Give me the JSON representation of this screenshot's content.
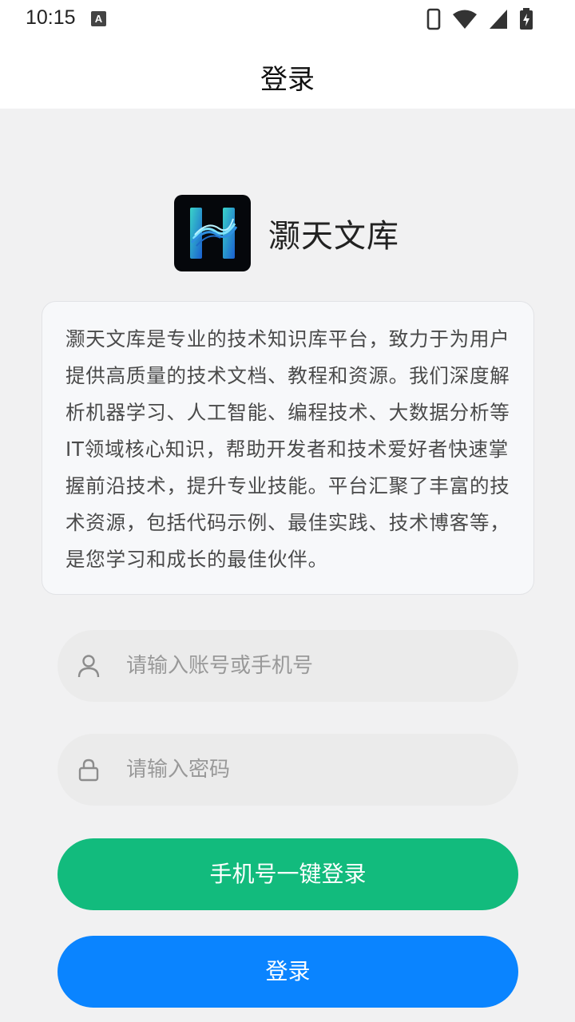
{
  "status_bar": {
    "time": "10:15",
    "keyboard_indicator": "A",
    "icons": [
      "phone-icon",
      "wifi-icon",
      "cellular-signal-icon",
      "battery-charging-icon"
    ]
  },
  "header": {
    "title": "登录"
  },
  "app": {
    "name": "灏天文库",
    "logo_icon": "h-logo-icon",
    "intro": "灏天文库是专业的技术知识库平台，致力于为用户提供高质量的技术文档、教程和资源。我们深度解析机器学习、人工智能、编程技术、大数据分析等IT领域核心知识，帮助开发者和技术爱好者快速掌握前沿技术，提升专业技能。平台汇聚了丰富的技术资源，包括代码示例、最佳实践、技术博客等，是您学习和成长的最佳伙伴。"
  },
  "form": {
    "account": {
      "value": "",
      "placeholder": "请输入账号或手机号",
      "icon": "user-icon"
    },
    "password": {
      "value": "",
      "placeholder": "请输入密码",
      "icon": "lock-icon"
    },
    "phone_login_button": "手机号一键登录",
    "login_button": "登录"
  },
  "colors": {
    "page_background": "#f1f1f2",
    "green_button": "#12bb7d",
    "blue_button": "#0a84ff"
  }
}
